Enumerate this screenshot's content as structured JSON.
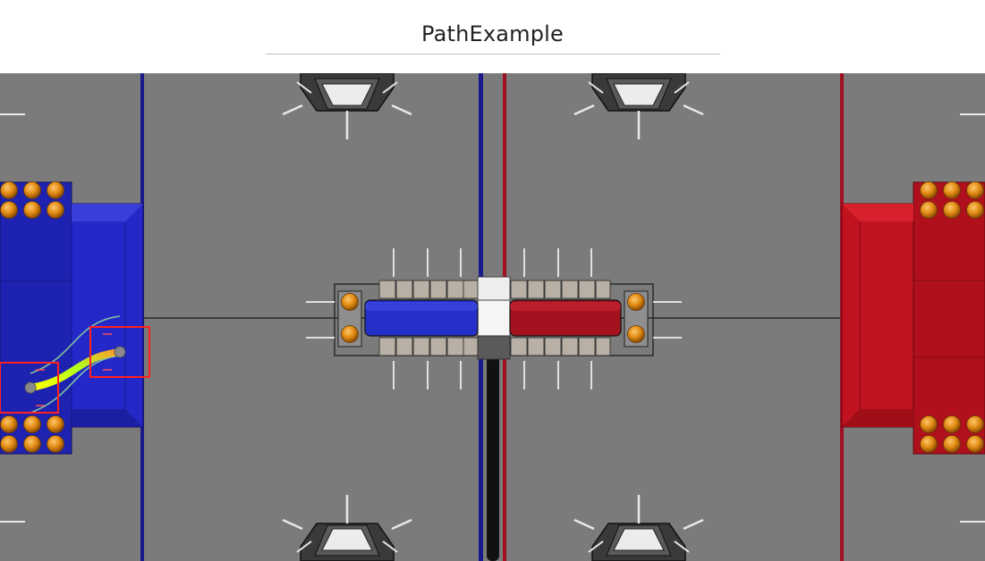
{
  "page": {
    "title": "PathExample"
  },
  "field": {
    "name": "field-canvas",
    "colors": {
      "carpet": "#7b7b7b",
      "blue_alliance": "#2528c8",
      "blue_line": "#1a1a8a",
      "red_alliance": "#c0131f",
      "red_line": "#a01020",
      "ball": "#e08a12",
      "selection_outline": "#ff2020",
      "waypoint": "#8a8a8a"
    },
    "path": {
      "gradient_start": "#ffff00",
      "gradient_mid": "#b0ff20",
      "gradient_end": "#ff9a2a"
    }
  }
}
